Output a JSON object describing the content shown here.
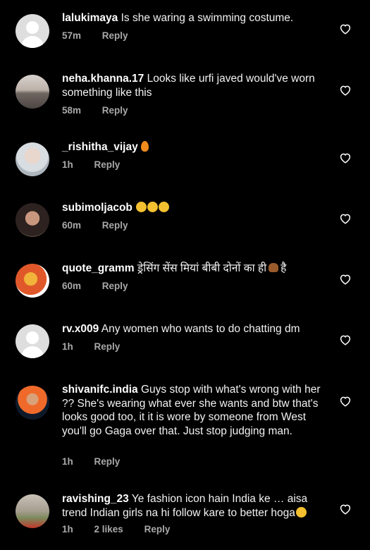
{
  "comments": [
    {
      "username": "lalukimaya",
      "text": "Is she waring a swimming costume.",
      "time": "57m",
      "likes": "",
      "reply": "Reply"
    },
    {
      "username": "neha.khanna.17",
      "text": "Looks like urfi javed would've worn something like this",
      "time": "58m",
      "likes": "",
      "reply": "Reply"
    },
    {
      "username": "_rishitha_vijay",
      "text": "",
      "time": "1h",
      "likes": "",
      "reply": "Reply"
    },
    {
      "username": "subimoljacob",
      "text": "",
      "time": "60m",
      "likes": "",
      "reply": "Reply"
    },
    {
      "username": "quote_gramm",
      "text": "ड्रेसिंग सेंस मियां बीबी दोनों का ही",
      "text_after": "है",
      "time": "60m",
      "likes": "",
      "reply": "Reply"
    },
    {
      "username": "rv.x009",
      "text": "Any women who wants to do chatting dm",
      "time": "1h",
      "likes": "",
      "reply": "Reply"
    },
    {
      "username": "shivanifc.india",
      "text": "Guys stop with what's wrong with her ?? She's wearing what ever she wants and btw that's looks good too, it it is wore by someone from West you'll go Gaga over that. Just stop judging man.",
      "time": "1h",
      "likes": "",
      "reply": "Reply"
    },
    {
      "username": "ravishing_23",
      "text": "Ye fashion icon hain India ke … aisa trend Indian girls na hi follow kare to better hoga",
      "time": "1h",
      "likes": "2 likes",
      "reply": "Reply"
    }
  ],
  "icons": {
    "like": "heart-outline-icon"
  },
  "colors": {
    "background": "#000000",
    "secondary_text": "#a8a8a8"
  }
}
